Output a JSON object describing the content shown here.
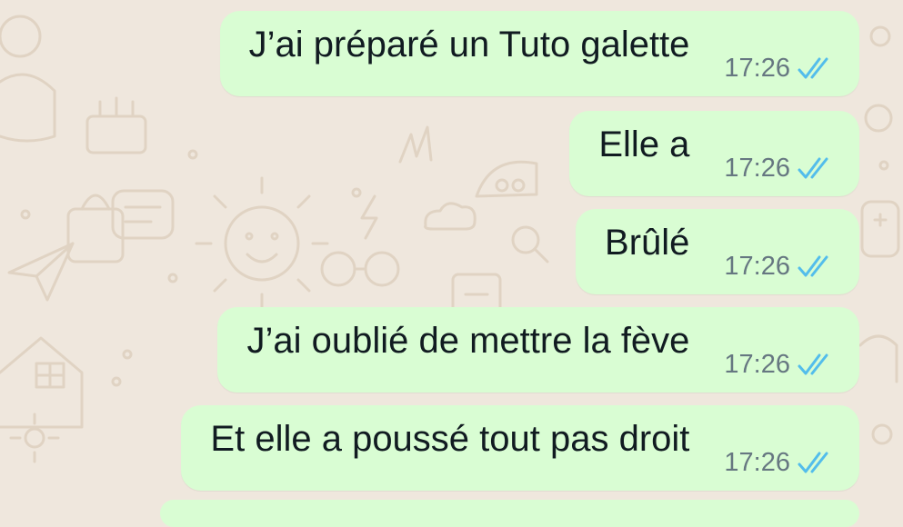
{
  "theme": {
    "wallpaper_color": "#efe7dd",
    "doodle_color": "#e0d3c3",
    "bubble_color": "#d9fdd3",
    "text_color": "#111b21",
    "time_color": "#667781",
    "read_tick_color": "#53bdeb"
  },
  "messages": [
    {
      "text": "J’ai préparé un Tuto galette",
      "time": "17:26",
      "status_icon": "double-check-read-icon"
    },
    {
      "text": "Elle a",
      "time": "17:26",
      "status_icon": "double-check-read-icon"
    },
    {
      "text": "Brûlé",
      "time": "17:26",
      "status_icon": "double-check-read-icon"
    },
    {
      "text": "J’ai oublié de mettre la fève",
      "time": "17:26",
      "status_icon": "double-check-read-icon"
    },
    {
      "text": "Et elle a poussé tout pas droit",
      "time": "17:26",
      "status_icon": "double-check-read-icon"
    }
  ]
}
